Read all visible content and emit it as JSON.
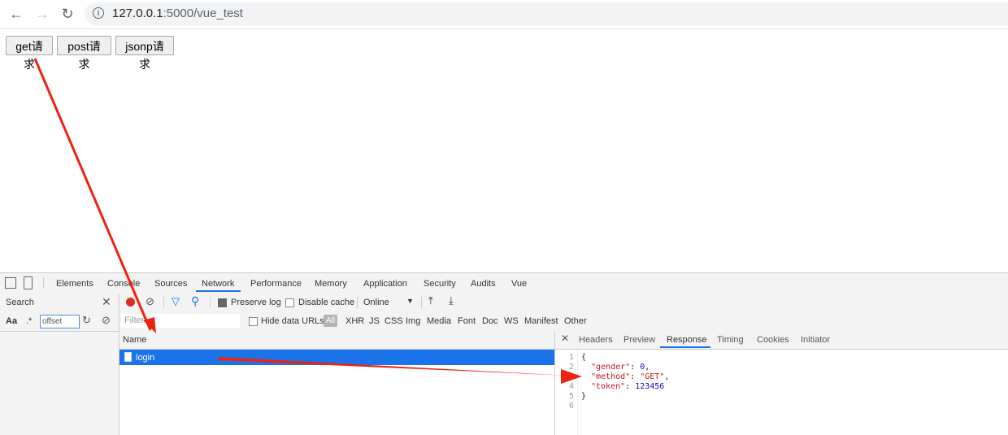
{
  "browser": {
    "url_host": "127.0.0.1",
    "url_rest": ":5000/vue_test"
  },
  "page": {
    "buttons": [
      "get请求",
      "post请求",
      "jsonp请求"
    ]
  },
  "devtools": {
    "tabs": [
      "Elements",
      "Console",
      "Sources",
      "Network",
      "Performance",
      "Memory",
      "Application",
      "Security",
      "Audits",
      "Vue"
    ],
    "active_tab": "Network",
    "search": {
      "title": "Search",
      "aa": "Aa",
      "regex": ".*",
      "query": "offset"
    },
    "toolbar": {
      "preserve_log": "Preserve log",
      "disable_cache": "Disable cache",
      "throttle": "Online"
    },
    "filter": {
      "placeholder": "Filter",
      "hide_data_urls": "Hide data URLs",
      "types": [
        "All",
        "XHR",
        "JS",
        "CSS",
        "Img",
        "Media",
        "Font",
        "Doc",
        "WS",
        "Manifest",
        "Other"
      ]
    },
    "requests": {
      "column": "Name",
      "rows": [
        "login"
      ]
    },
    "detail": {
      "tabs": [
        "Headers",
        "Preview",
        "Response",
        "Timing",
        "Cookies",
        "Initiator"
      ],
      "active_tab": "Response",
      "line_numbers": [
        "1",
        "2",
        "3",
        "4",
        "5",
        "6"
      ],
      "response": {
        "open": "{",
        "k1": "\"gender\"",
        "v1": "0",
        "k2": "\"method\"",
        "v2": "\"GET\"",
        "k3": "\"token\"",
        "v3": "123456",
        "close": "}"
      }
    }
  },
  "colors": {
    "accent": "#1a73e8",
    "annotation": "#ee2211",
    "record": "#d93025"
  }
}
